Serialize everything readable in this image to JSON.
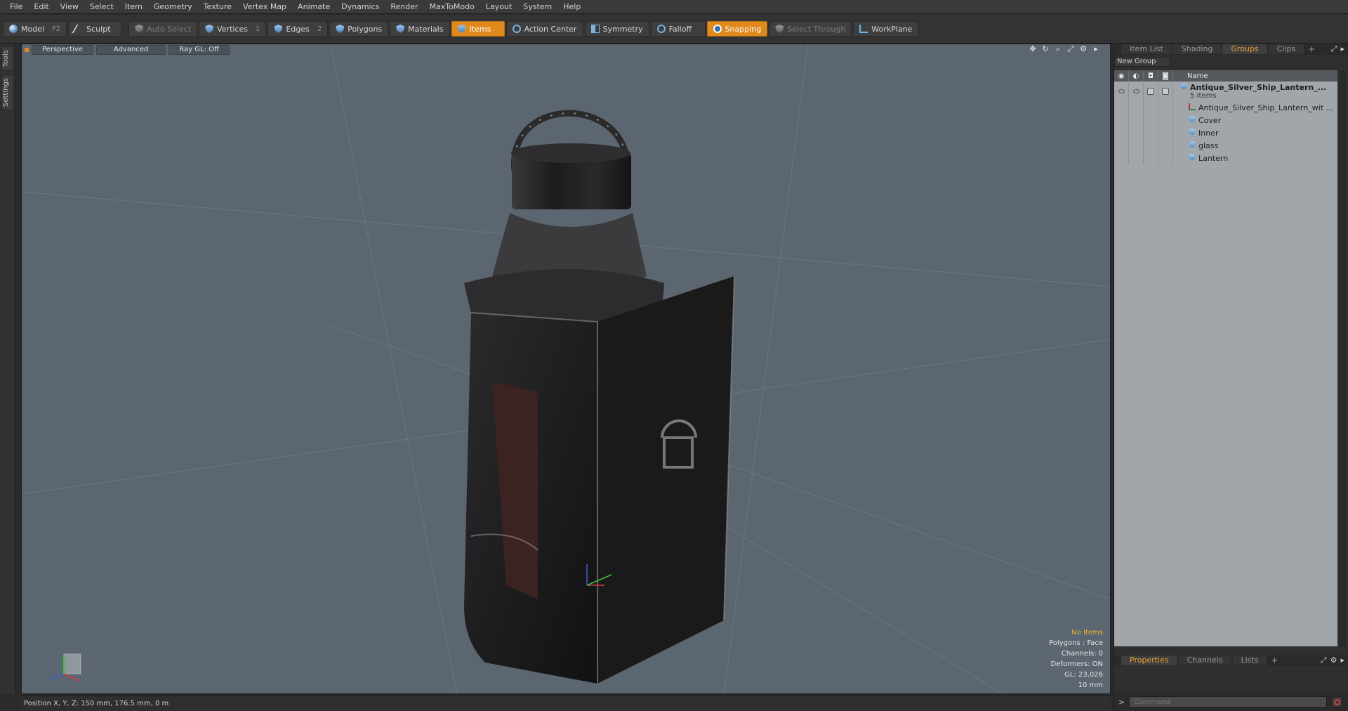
{
  "menu": [
    "File",
    "Edit",
    "View",
    "Select",
    "Item",
    "Geometry",
    "Texture",
    "Vertex Map",
    "Animate",
    "Dynamics",
    "Render",
    "MaxToModo",
    "Layout",
    "System",
    "Help"
  ],
  "toolbar": {
    "model": "Model",
    "model_key": "F2",
    "sculpt": "Sculpt",
    "auto_select": "Auto Select",
    "vertices": "Vertices",
    "vertices_key": "1",
    "edges": "Edges",
    "edges_key": "2",
    "polygons": "Polygons",
    "materials": "Materials",
    "items": "Items",
    "action_center": "Action Center",
    "symmetry": "Symmetry",
    "falloff": "Falloff",
    "snapping": "Snapping",
    "select_through": "Select Through",
    "workplane": "WorkPlane"
  },
  "left_tabs": {
    "tools": "Tools",
    "settings": "Settings"
  },
  "viewport": {
    "perspective": "Perspective",
    "advanced": "Advanced",
    "raygl": "Ray GL: Off",
    "stats": {
      "no_items": "No Items",
      "polygons": "Polygons : Face",
      "channels": "Channels: 0",
      "deformers": "Deformers: ON",
      "gl": "GL: 23,026",
      "unit": "10 mm"
    }
  },
  "status": {
    "position": "Position X, Y, Z:   150 mm, 176.5 mm, 0 m"
  },
  "panel": {
    "tabs": [
      "Item List",
      "Shading",
      "Groups",
      "Clips"
    ],
    "active_tab": "Groups",
    "new_group": "New Group",
    "name_header": "Name",
    "group": {
      "name": "Antique_Silver_Ship_Lantern_...",
      "count": "5 Items",
      "children": [
        "Antique_Silver_Ship_Lantern_wit ...",
        "Cover",
        "Inner",
        "glass",
        "Lantern"
      ]
    },
    "bottom_tabs": [
      "Properties",
      "Channels",
      "Lists"
    ],
    "command_placeholder": "Command"
  },
  "colors": {
    "accent": "#e08a1e",
    "viewport_bg": "#5b6670",
    "highlight_text": "#f0b030"
  }
}
